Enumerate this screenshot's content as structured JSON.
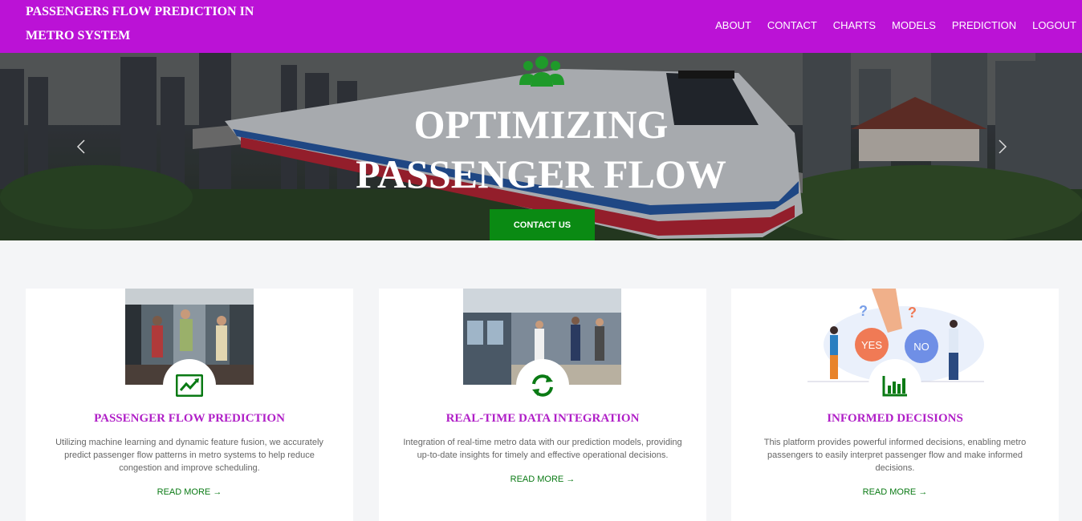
{
  "header": {
    "brand_line1": "PASSENGERS FLOW PREDICTION IN",
    "brand_line2": "METRO SYSTEM",
    "nav": [
      "ABOUT",
      "CONTACT",
      "CHARTS",
      "MODELS",
      "PREDICTION",
      "LOGOUT"
    ]
  },
  "hero": {
    "title_line1": "OPTIMIZING",
    "title_line2": "PASSENGER FLOW",
    "button": "CONTACT US",
    "icon": "people-group-icon",
    "accent": "#0a8a13"
  },
  "cards": [
    {
      "title": "PASSENGER FLOW PREDICTION",
      "desc": "Utilizing machine learning and dynamic feature fusion, we accurately predict passenger flow patterns in metro systems to help reduce congestion and improve scheduling.",
      "link": "READ MORE →",
      "icon": "trend-chart-icon"
    },
    {
      "title": "REAL-TIME DATA INTEGRATION",
      "desc": "Integration of real-time metro data with our prediction models, providing up-to-date insights for timely and effective operational decisions.",
      "link": "READ MORE →",
      "icon": "sync-icon"
    },
    {
      "title": "INFORMED DECISIONS",
      "desc": "This platform provides powerful informed decisions, enabling metro passengers to easily interpret passenger flow and make informed decisions.",
      "link": "READ MORE →",
      "icon": "bar-chart-icon",
      "illustration": {
        "yes": "YES",
        "no": "NO"
      }
    }
  ],
  "colors": {
    "header": "#bb12d6",
    "title": "#b01fc7",
    "green": "#0a8a13"
  }
}
